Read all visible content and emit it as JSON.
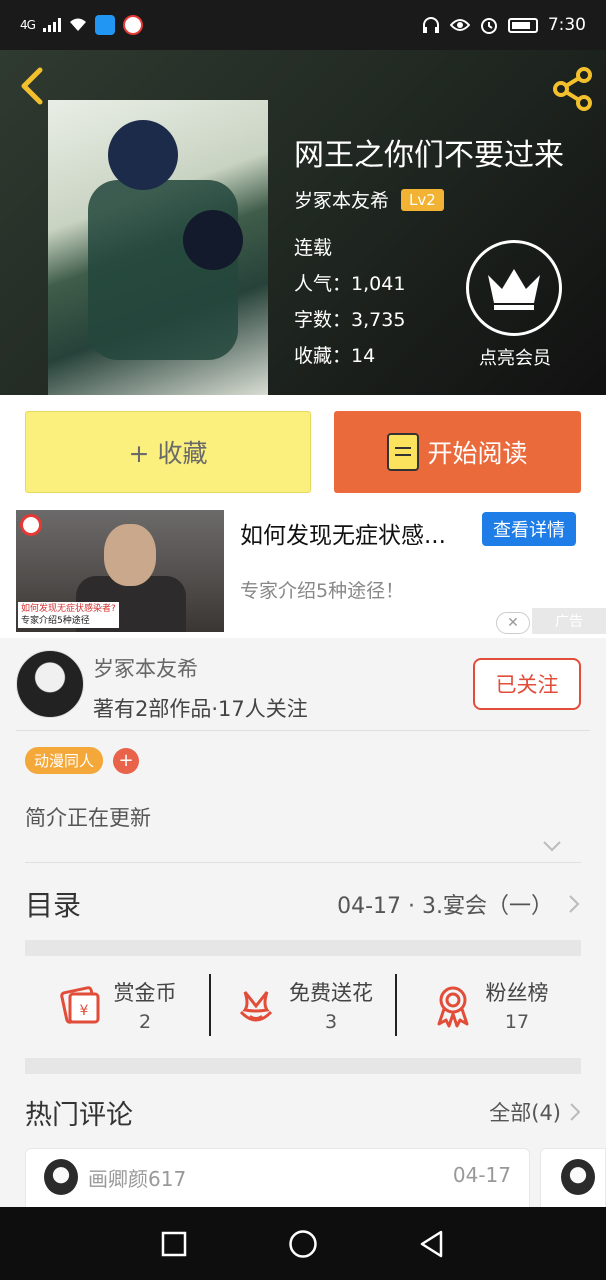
{
  "status_bar": {
    "network": "4G",
    "time": "7:30"
  },
  "header": {
    "book_title": "网王之你们不要过来",
    "author": "岁冢本友希",
    "level_badge": "Lv2",
    "status": "连载",
    "popularity_label": "人气：",
    "popularity": "1,041",
    "word_count_label": "字数：",
    "word_count": "3,735",
    "favorites_label": "收藏：",
    "favorites": "14",
    "vip_label": "点亮会员"
  },
  "actions": {
    "favorite_label": "+ 收藏",
    "read_label": "开始阅读"
  },
  "ad": {
    "title": "如何发现无症状感...",
    "button": "查看详情",
    "subtitle": "专家介绍5种途径！",
    "image_caption_1": "如何发现无症状感染者?",
    "image_caption_2": "专家介绍5种途径",
    "close_icon": "✕",
    "ad_tag": "广告"
  },
  "author_card": {
    "name": "岁冢本友希",
    "works": "著有2部作品·17人关注",
    "follow_label": "已关注"
  },
  "tags": {
    "items": [
      "动漫同人"
    ],
    "add": "+"
  },
  "intro": {
    "text": "简介正在更新"
  },
  "toc": {
    "title": "目录",
    "latest": "04-17 · 3.宴会（一）"
  },
  "stats": [
    {
      "label": "赏金币",
      "value": "2",
      "icon": "red-envelope-icon"
    },
    {
      "label": "免费送花",
      "value": "3",
      "icon": "flower-icon"
    },
    {
      "label": "粉丝榜",
      "value": "17",
      "icon": "medal-icon"
    }
  ],
  "comments": {
    "title": "热门评论",
    "all_label": "全部(4)",
    "items": [
      {
        "user": "画卿颜617",
        "date": "04-17"
      }
    ]
  },
  "colors": {
    "accent_orange": "#ea6a3b",
    "favorite_yellow": "#fbef7e",
    "follow_red": "#e24d3a",
    "icon_red": "#e24d3a",
    "badge_gold": "#f2b233",
    "back_yellow": "#f3c02d"
  }
}
